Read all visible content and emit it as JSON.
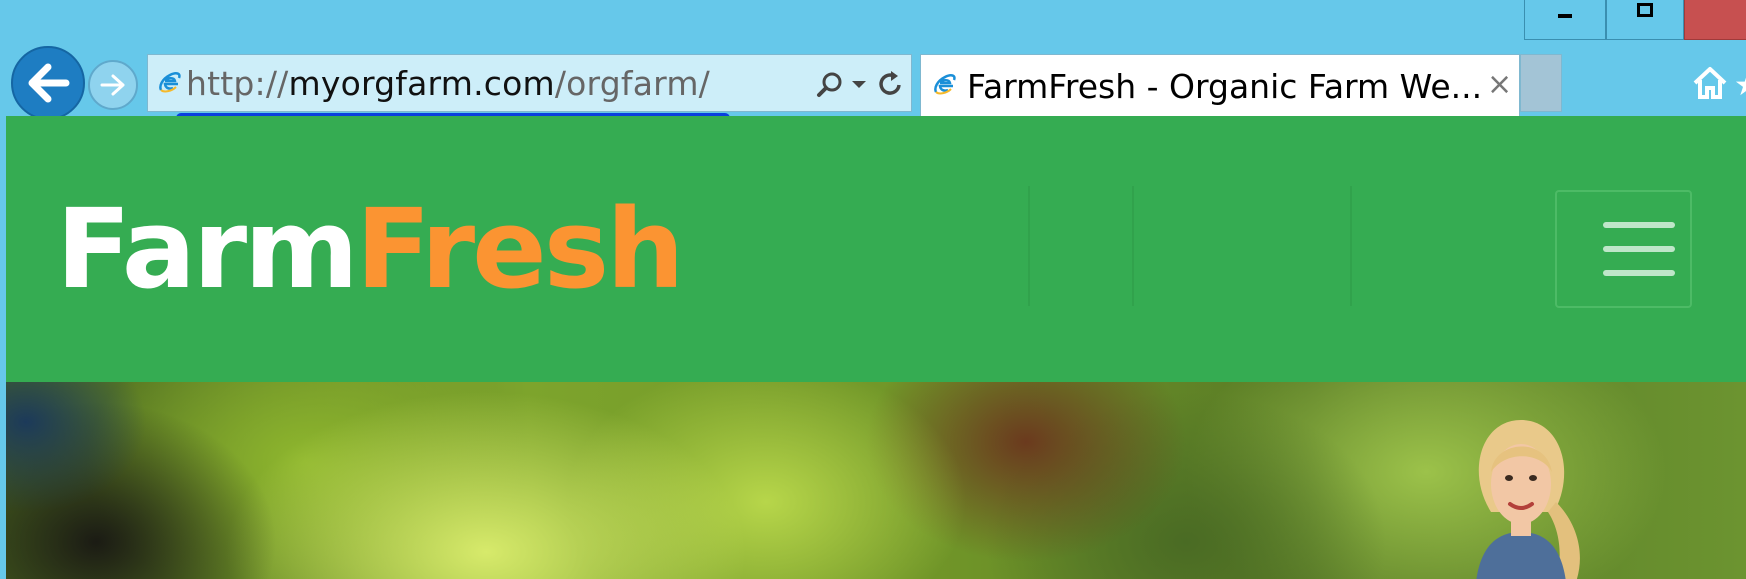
{
  "browser": {
    "address_bar": {
      "url_prefix": "http://",
      "url_domain": "myorgfarm.com",
      "url_path": "/orgfarm/"
    },
    "tab": {
      "title": "FarmFresh - Organic Farm We...",
      "close_label": "×"
    }
  },
  "site": {
    "brand_part1": "Farm",
    "brand_part2": "Fresh",
    "colors": {
      "header_bg": "#35ac52",
      "brand_accent": "#fb9432",
      "brand_primary": "#ffffff"
    }
  },
  "icons": {
    "back": "back-arrow-icon",
    "forward": "forward-arrow-icon",
    "search": "search-icon",
    "dropdown": "chevron-down-icon",
    "refresh": "refresh-icon",
    "favicon": "ie-icon",
    "home": "home-icon",
    "favorites": "star-icon",
    "menu": "hamburger-icon"
  }
}
